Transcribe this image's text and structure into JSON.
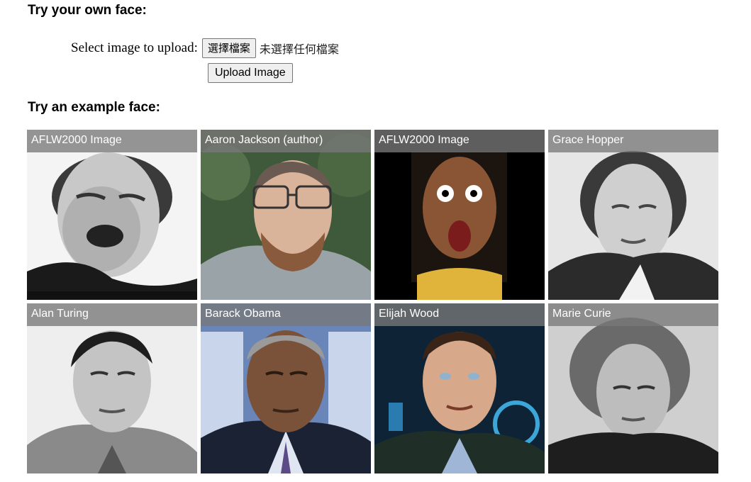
{
  "own_face": {
    "heading": "Try your own face:",
    "select_label": "Select image to upload:",
    "choose_file_label": "選擇檔案",
    "no_file_text": "未選擇任何檔案",
    "upload_button": "Upload Image"
  },
  "examples": {
    "heading": "Try an example face:",
    "tiles": [
      {
        "caption": "AFLW2000 Image"
      },
      {
        "caption": "Aaron Jackson (author)"
      },
      {
        "caption": "AFLW2000 Image"
      },
      {
        "caption": "Grace Hopper"
      },
      {
        "caption": "Alan Turing"
      },
      {
        "caption": "Barack Obama"
      },
      {
        "caption": "Elijah Wood"
      },
      {
        "caption": "Marie Curie"
      }
    ]
  }
}
